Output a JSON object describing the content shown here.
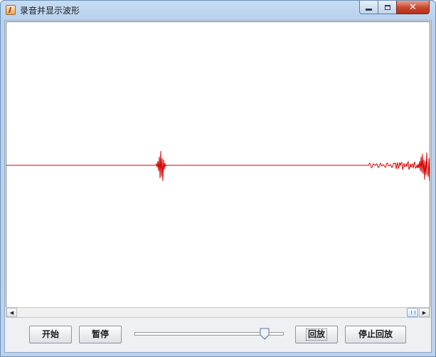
{
  "window": {
    "title": "录音并显示波形",
    "controls": {
      "minimize": "minimize",
      "maximize": "maximize",
      "close": "✕"
    }
  },
  "waveform": {
    "color": "#d40000",
    "baseline_color": "#d40000"
  },
  "scrollbar": {
    "orientation": "horizontal",
    "position": 0.97
  },
  "buttons": {
    "start": "开始",
    "pause": "暂停",
    "replay": "回放",
    "stop_replay": "停止回放"
  },
  "volume_slider": {
    "value": 0.9
  },
  "icons": {
    "app": "java-coffee-icon",
    "scroll_left": "arrow-left-icon",
    "scroll_right": "arrow-right-icon"
  }
}
